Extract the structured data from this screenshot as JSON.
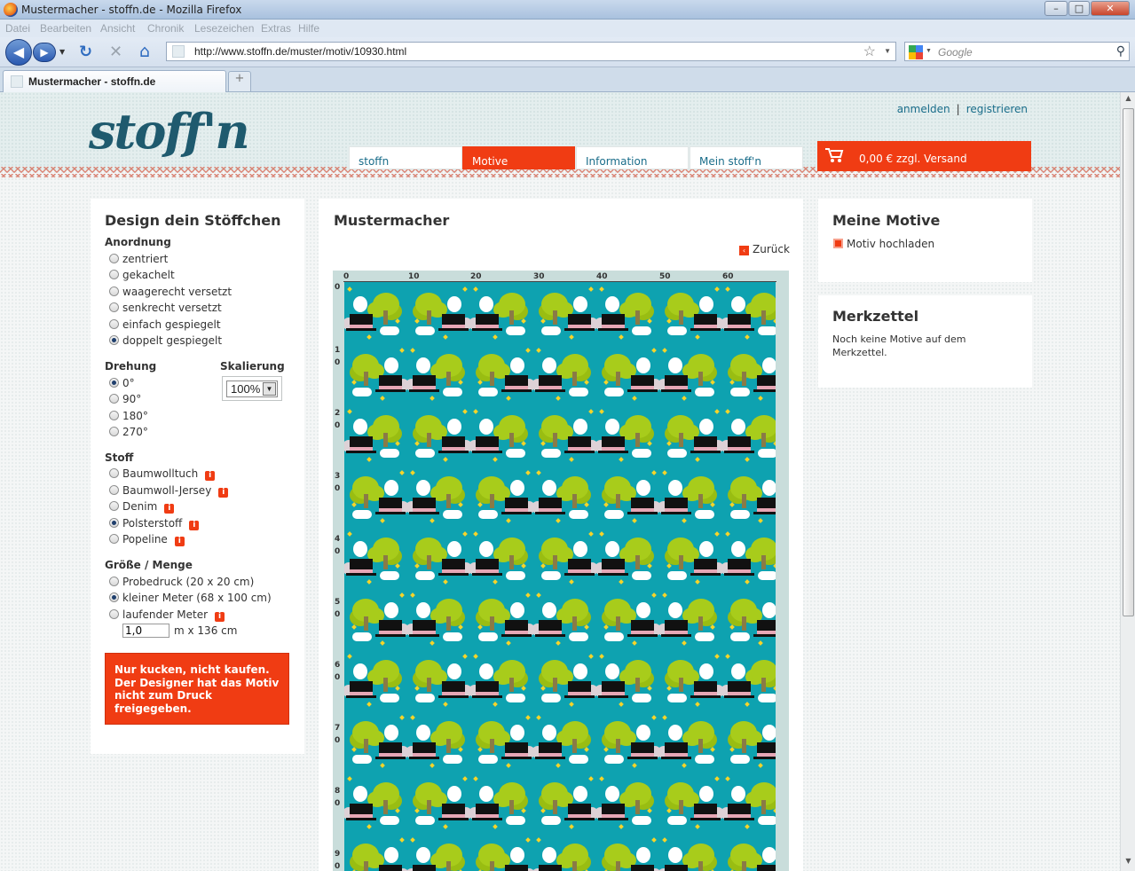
{
  "browser": {
    "window_title": "Mustermacher - stoffn.de - Mozilla Firefox",
    "menu": [
      "Datei",
      "Bearbeiten",
      "Ansicht",
      "Chronik",
      "Lesezeichen",
      "Extras",
      "Hilfe"
    ],
    "url": "http://www.stoffn.de/muster/motiv/10930.html",
    "search_placeholder": "Google",
    "tab_title": "Mustermacher - stoffn.de",
    "new_tab": "+"
  },
  "site": {
    "logo": "stoff'n",
    "login": "anmelden",
    "register": "registrieren",
    "nav": [
      "stoffn",
      "Motive",
      "Information",
      "Mein stoff'n"
    ],
    "active_nav": "Motive",
    "cart": "0,00 € zzgl. Versand",
    "accent_color": "#f03c13"
  },
  "left": {
    "title": "Design dein Stöffchen",
    "arrangement_label": "Anordnung",
    "arrangement": [
      "zentriert",
      "gekachelt",
      "waagerecht versetzt",
      "senkrecht versetzt",
      "einfach gespiegelt",
      "doppelt gespiegelt"
    ],
    "arrangement_selected": "doppelt gespiegelt",
    "rotation_label": "Drehung",
    "rotation": [
      "0°",
      "90°",
      "180°",
      "270°"
    ],
    "rotation_selected": "0°",
    "scale_label": "Skalierung",
    "scale_value": "100%",
    "fabric_label": "Stoff",
    "fabric": [
      "Baumwolltuch",
      "Baumwoll-Jersey",
      "Denim",
      "Polsterstoff",
      "Popeline"
    ],
    "fabric_selected": "Polsterstoff",
    "size_label": "Größe / Menge",
    "size": [
      "Probedruck (20 x 20 cm)",
      "kleiner Meter (68 x 100 cm)",
      "laufender Meter"
    ],
    "size_selected": "kleiner Meter (68 x 100 cm)",
    "meter_value": "1,0",
    "meter_suffix": "m x 136 cm",
    "notice": "Nur kucken, nicht kaufen. Der Designer hat das Motiv nicht zum Druck freigegeben."
  },
  "center": {
    "title": "Mustermacher",
    "back": "Zurück",
    "ruler_x": [
      "0",
      "10",
      "20",
      "30",
      "40",
      "50",
      "60"
    ],
    "ruler_y": [
      "0",
      "1 0",
      "2 0",
      "3 0",
      "4 0",
      "5 0",
      "6 0",
      "7 0",
      "8 0",
      "9 0"
    ]
  },
  "right": {
    "motifs_title": "Meine Motive",
    "upload": "Motiv hochladen",
    "notes_title": "Merkzettel",
    "notes_text": "Noch keine Motive auf dem Merkzettel."
  }
}
